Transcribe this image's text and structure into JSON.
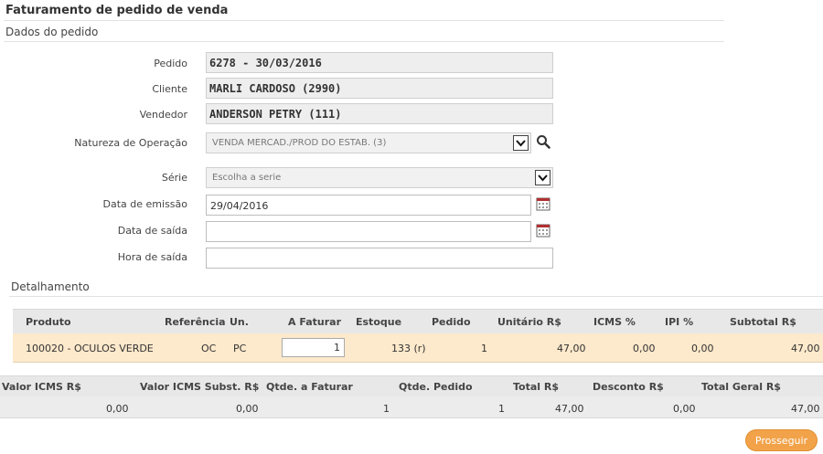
{
  "page": {
    "title": "Faturamento de pedido de venda"
  },
  "order_section": {
    "title": "Dados do pedido",
    "pedido_label": "Pedido",
    "pedido_value": "6278 - 30/03/2016",
    "cliente_label": "Cliente",
    "cliente_value": "MARLI CARDOSO (2990)",
    "vendedor_label": "Vendedor",
    "vendedor_value": "ANDERSON PETRY (111)",
    "natureza_label": "Natureza de Operação",
    "natureza_value": "VENDA MERCAD./PROD DO ESTAB. (3)",
    "serie_label": "Série",
    "serie_value": "Escolha a serie",
    "data_emissao_label": "Data de emissão",
    "data_emissao_value": "29/04/2016",
    "data_saida_label": "Data de saída",
    "data_saida_value": "",
    "hora_saida_label": "Hora de saída",
    "hora_saida_value": ""
  },
  "details": {
    "title": "Detalhamento",
    "headers": {
      "produto": "Produto",
      "referencia": "Referência",
      "un": "Un.",
      "a_faturar": "A Faturar",
      "estoque": "Estoque",
      "pedido": "Pedido",
      "unitario": "Unitário R$",
      "icms": "ICMS %",
      "ipi": "IPI %",
      "subtotal": "Subtotal R$"
    },
    "row": {
      "produto": "100020 - OCULOS VERDE",
      "referencia": "OC",
      "un": "PC",
      "a_faturar": "1",
      "estoque": "133 (r)",
      "pedido": "1",
      "unitario": "47,00",
      "icms": "0,00",
      "ipi": "0,00",
      "subtotal": "47,00"
    }
  },
  "totals": {
    "headers": {
      "valor_icms": "Valor ICMS R$",
      "valor_icms_subst": "Valor ICMS Subst. R$",
      "qtde_faturar": "Qtde. a Faturar",
      "qtde_pedido": "Qtde. Pedido",
      "total": "Total R$",
      "desconto": "Desconto R$",
      "total_geral": "Total Geral R$"
    },
    "row": {
      "valor_icms": "0,00",
      "valor_icms_subst": "0,00",
      "qtde_faturar": "1",
      "qtde_pedido": "1",
      "total": "47,00",
      "desconto": "0,00",
      "total_geral": "47,00"
    }
  },
  "actions": {
    "proceed_label": "Prosseguir"
  },
  "colors": {
    "accent": "#f2a34a",
    "row_highlight": "#fde9cb"
  },
  "icons": {
    "search": "magnifier-icon",
    "calendar": "calendar-icon",
    "dropdown": "chevron-down-icon"
  }
}
